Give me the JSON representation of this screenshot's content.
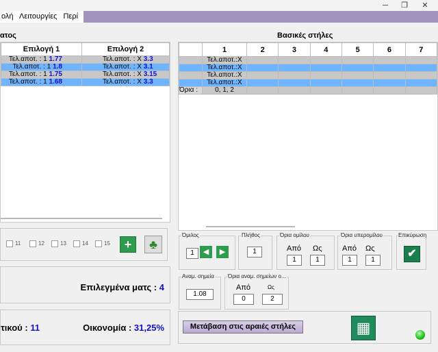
{
  "menu": {
    "items": [
      "ολή",
      "Λειτουργίες",
      "Περί"
    ]
  },
  "window": {
    "min_icon": "minimize-icon",
    "max_icon": "restore-icon",
    "close_icon": "close-icon"
  },
  "left_panel": {
    "title": "ατος",
    "columns": [
      "Επιλογή 1",
      "Επιλογή 2"
    ],
    "rows": [
      {
        "c1_label": "Τελ.αποτ. : 1",
        "c1_val": "1.77",
        "c2_label": "Τελ.αποτ. : Χ",
        "c2_val": "3.3",
        "style": "grey"
      },
      {
        "c1_label": "Τελ.αποτ. : 1",
        "c1_val": "1.8",
        "c2_label": "Τελ.αποτ. : Χ",
        "c2_val": "3.1",
        "style": "blue"
      },
      {
        "c1_label": "Τελ.αποτ. : 1",
        "c1_val": "1.75",
        "c2_label": "Τελ.αποτ. : Χ",
        "c2_val": "3.15",
        "style": "grey"
      },
      {
        "c1_label": "Τελ.αποτ. : 1",
        "c1_val": "1.68",
        "c2_label": "Τελ.αποτ. : Χ",
        "c2_val": "3.3",
        "style": "blue"
      }
    ]
  },
  "checkboxes": [
    "11",
    "12",
    "13",
    "14",
    "15"
  ],
  "selected_matches": {
    "label": "Επιλεγμένα ματς :",
    "value": "4"
  },
  "economy": {
    "left_label": "τικού :",
    "left_value": "11",
    "label": "Οικονομία :",
    "value": "31,25%"
  },
  "right_panel": {
    "title": "Βασικές στήλες",
    "columns": [
      "1",
      "2",
      "3",
      "4",
      "5",
      "6",
      "7"
    ],
    "rows": [
      {
        "text": "Τελ.αποτ.:Χ",
        "style": "grey"
      },
      {
        "text": "Τελ.αποτ.:Χ",
        "style": "blue"
      },
      {
        "text": "Τελ.αποτ.:Χ",
        "style": "grey"
      },
      {
        "text": "Τελ.αποτ.:Χ",
        "style": "blue"
      }
    ],
    "limits_label": "Όρια :",
    "limits_value": "0, 1, 2"
  },
  "controls": {
    "group": {
      "label": "Όμιλος",
      "value": "1"
    },
    "count": {
      "label": "Πλήθος",
      "value": "1"
    },
    "group_limits": {
      "label": "Όρια ομίλου",
      "from_label": "Από",
      "to_label": "Ως",
      "from": "1",
      "to": "1"
    },
    "over_limits": {
      "label": "Όρια υπερομίλου",
      "from_label": "Από",
      "to_label": "Ως",
      "from": "1",
      "to": "1"
    },
    "confirm": {
      "label": "Επικύρωση"
    },
    "points": {
      "label": "Αναμ. σημεία",
      "value": "1.08"
    },
    "points_limits": {
      "label": "Όρια αναμ. σημείων ο...",
      "from_label": "Από",
      "to_label": "Ως",
      "from": "0",
      "to": "2"
    },
    "goto_button": "Μετάβαση στις αραιές στήλες"
  }
}
